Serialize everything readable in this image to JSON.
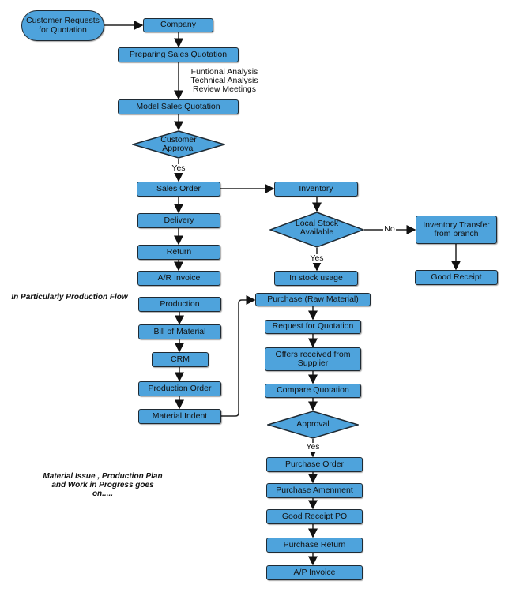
{
  "colors": {
    "node_fill": "#4ea3dc",
    "stroke": "#1f2a33"
  },
  "nodes": {
    "start": "Customer Requests for Quotation",
    "company": "Company",
    "preparing": "Preparing Sales Quotation",
    "analysis": "Funtional Analysis\nTechnical Analysis\nReview Meetings",
    "model": "Model Sales Quotation",
    "cust_approval": "Customer Approval",
    "yes1": "Yes",
    "sales_order": "Sales Order",
    "delivery": "Delivery",
    "return": "Return",
    "ar_invoice": "A/R Invoice",
    "inventory": "Inventory",
    "local_stock": "Local Stock Available",
    "no": "No",
    "transfer": "Inventory Transfer from branch",
    "good_receipt": "Good Receipt",
    "yes2": "Yes",
    "in_stock": "In stock usage",
    "prod_note": "In Particularly Production Flow",
    "production": "Production",
    "bom": "Bill of Material",
    "crm": "CRM",
    "prod_order": "Production Order",
    "mat_indent": "Material Indent",
    "purchase_raw": "Purchase (Raw Material)",
    "rfq": "Request for Quotation",
    "offers": "Offers received from Supplier",
    "compare": "Compare Quotation",
    "approval": "Approval",
    "yes3": "Yes",
    "po": "Purchase Order",
    "amend": "Purchase Amenment",
    "grpo": "Good Receipt PO",
    "preturn": "Purchase Return",
    "ap_invoice": "A/P Invoice",
    "end_note": "Material Issue , Production Plan and Work in Progress goes on....."
  }
}
